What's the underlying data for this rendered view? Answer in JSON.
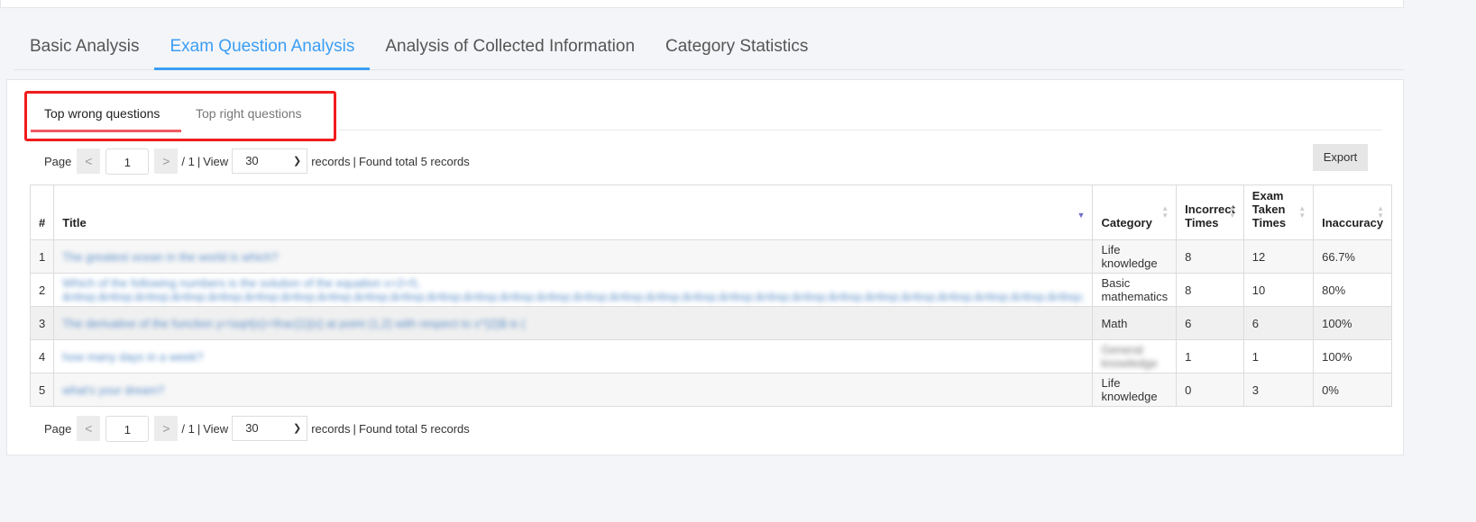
{
  "main_tabs": [
    "Basic Analysis",
    "Exam Question Analysis",
    "Analysis of Collected Information",
    "Category Statistics"
  ],
  "active_main_tab": 1,
  "sub_tabs": [
    "Top wrong questions",
    "Top right questions"
  ],
  "pagination": {
    "page_label": "Page",
    "prev": "<",
    "next": ">",
    "current_page": "1",
    "total": "/ 1",
    "view_label": "View",
    "page_size": "30",
    "records_label": "records",
    "found_text": "Found total 5 records"
  },
  "export_label": "Export",
  "table": {
    "headers": [
      "#",
      "Title",
      "Category",
      "Incorrect Times",
      "Exam Taken Times",
      "Inaccuracy"
    ],
    "rows": [
      {
        "n": "1",
        "title": "The greatest ocean in the world is which?",
        "category": "Life knowledge",
        "incorrect": "8",
        "taken": "12",
        "inaccuracy": "66.7%"
      },
      {
        "n": "2",
        "title": "Which of the following numbers is the solution of the equation x+2=5, &nbsp;&nbsp;&nbsp;&nbsp;&nbsp;&nbsp;&nbsp;&nbsp;&nbsp;&nbsp;&nbsp;&nbsp;&nbsp;&nbsp;&nbsp;&nbsp;&nbsp;&nbsp;&nbsp;&nbsp;&nbsp;&nbsp;&nbsp;&nbsp;&nbsp;&nbsp;&nbsp;&nbsp;",
        "category": "Basic mathematics",
        "incorrect": "8",
        "taken": "10",
        "inaccuracy": "80%"
      },
      {
        "n": "3",
        "title": "The derivative of the function y=\\sqrt{x}+\\frac{1}{x} at point (1,2) with respect to x^{2}$ is (",
        "category": "Math",
        "incorrect": "6",
        "taken": "6",
        "inaccuracy": "100%"
      },
      {
        "n": "4",
        "title": "how many days in a week?",
        "category": "General knowledge",
        "incorrect": "1",
        "taken": "1",
        "inaccuracy": "100%"
      },
      {
        "n": "5",
        "title": "what's your dream?",
        "category": "Life knowledge",
        "incorrect": "0",
        "taken": "3",
        "inaccuracy": "0%"
      }
    ]
  },
  "colors": {
    "accent": "#3a9ef5",
    "highlight_box": "#f21c1c",
    "subtab_underline": "#f25a63"
  }
}
